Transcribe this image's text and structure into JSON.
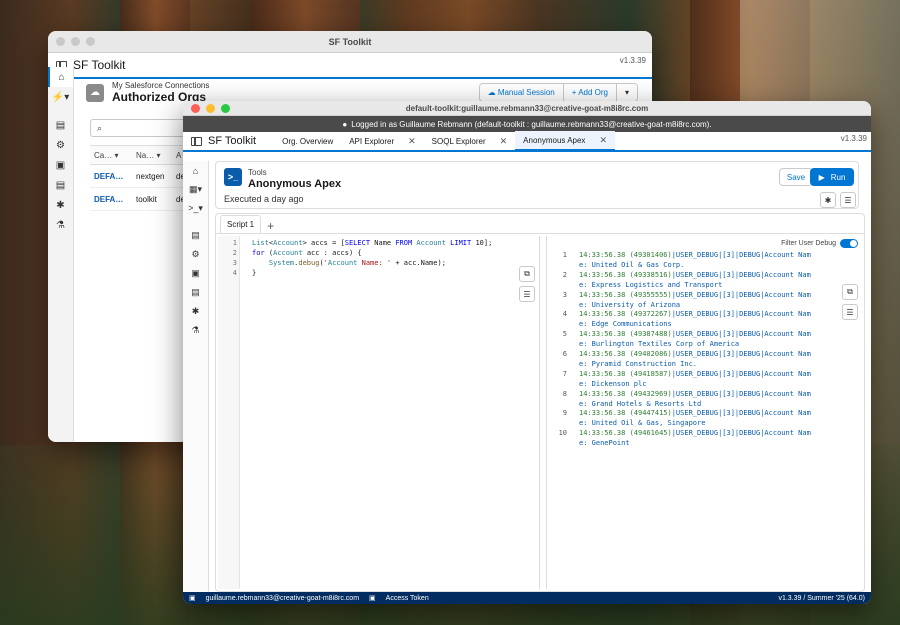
{
  "back_window": {
    "window_title": "SF Toolkit",
    "app_name": "SF Toolkit",
    "version": "v1.3.39",
    "sidebar_icons": [
      "home-icon",
      "bolt-icon",
      "book-icon",
      "gear-icon",
      "clipboard-icon",
      "book-icon",
      "bug-icon",
      "flask-icon"
    ],
    "header_sub": "My Salesforce Connections",
    "header_title": "Authorized Orgs",
    "manual_session_label": "Manual Session",
    "add_org_label": "Add Org",
    "table_headers": [
      "Ca…",
      "Na…",
      "A"
    ],
    "rows": [
      {
        "alias": "DEFA…",
        "name": "nextgen",
        "extra": "de"
      },
      {
        "alias": "DEFA…",
        "name": "toolkit",
        "extra": "de"
      }
    ]
  },
  "front_window": {
    "window_title": "default-toolkit:guillaume.rebmann33@creative-goat-m8i8rc.com",
    "banner_text": "Logged in as Guillaume Rebmann (default-toolkit : guillaume.rebmann33@creative-goat-m8i8rc.com).",
    "app_name": "SF Toolkit",
    "version": "v1.3.39",
    "tabs": [
      {
        "label": "Org. Overview",
        "closable": false
      },
      {
        "label": "API Explorer",
        "closable": true
      },
      {
        "label": "SOQL Explorer",
        "closable": true
      },
      {
        "label": "Anonymous Apex",
        "closable": true,
        "active": true
      }
    ],
    "tool_sub": "Tools",
    "tool_title": "Anonymous Apex",
    "executed_text": "Executed a day ago",
    "save_label": "Save",
    "run_label": "Run",
    "script_tab": "Script 1",
    "add_tab": "+",
    "filter_label": "Filter User Debug",
    "filter_on": true,
    "code_lines": [
      "List<Account> accs = [SELECT Name FROM Account LIMIT 10];",
      "for (Account acc : accs) {",
      "    System.debug('Account Name: ' + acc.Name);",
      "}"
    ],
    "log_lines": [
      {
        "ts": "14:33:56.38 (49301406)",
        "rest": "|USER_DEBUG|[3]|DEBUG|Account Name: United Oil & Gas Corp."
      },
      {
        "ts": "14:33:56.38 (49338516)",
        "rest": "|USER_DEBUG|[3]|DEBUG|Account Name: Express Logistics and Transport"
      },
      {
        "ts": "14:33:56.38 (49355555)",
        "rest": "|USER_DEBUG|[3]|DEBUG|Account Name: University of Arizona"
      },
      {
        "ts": "14:33:56.38 (49372267)",
        "rest": "|USER_DEBUG|[3]|DEBUG|Account Name: Edge Communications"
      },
      {
        "ts": "14:33:56.38 (49387488)",
        "rest": "|USER_DEBUG|[3]|DEBUG|Account Name: Burlington Textiles Corp of America"
      },
      {
        "ts": "14:33:56.38 (49402086)",
        "rest": "|USER_DEBUG|[3]|DEBUG|Account Name: Pyramid Construction Inc."
      },
      {
        "ts": "14:33:56.38 (49418587)",
        "rest": "|USER_DEBUG|[3]|DEBUG|Account Name: Dickenson plc"
      },
      {
        "ts": "14:33:56.38 (49432969)",
        "rest": "|USER_DEBUG|[3]|DEBUG|Account Name: Grand Hotels & Resorts Ltd"
      },
      {
        "ts": "14:33:56.38 (49447415)",
        "rest": "|USER_DEBUG|[3]|DEBUG|Account Name: United Oil & Gas, Singapore"
      },
      {
        "ts": "14:33:56.38 (49461645)",
        "rest": "|USER_DEBUG|[3]|DEBUG|Account Name: GenePoint"
      }
    ],
    "status_user": "guillaume.rebmann33@creative-goat-m8i8rc.com",
    "status_token": "Access Token",
    "status_version": "v1.3.39 / Summer '25 (64.0)"
  }
}
